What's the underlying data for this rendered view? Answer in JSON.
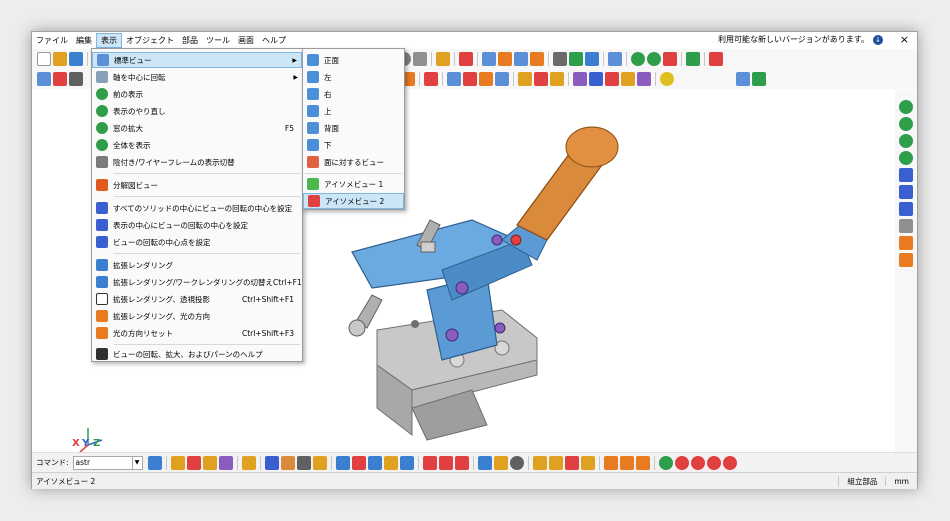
{
  "menubar": {
    "items": [
      "ファイル",
      "編集",
      "表示",
      "オブジェクト",
      "部品",
      "ツール",
      "画面",
      "ヘルプ"
    ],
    "active_index": 2
  },
  "update_notice": "利用可能な新しいバージョンがあります。",
  "view_menu": {
    "items": [
      {
        "label": "標準ビュー",
        "shortcut": "",
        "submenu": true,
        "icon": "standard-view-icon",
        "color": "#5b8fd8"
      },
      {
        "label": "軸を中心に回転",
        "shortcut": "",
        "submenu": true,
        "icon": "rotate-axis-icon",
        "color": "#8aa0b8"
      },
      {
        "label": "前の表示",
        "shortcut": "",
        "icon": "previous-view-icon",
        "color": "#2f9e4a"
      },
      {
        "label": "表示のやり直し",
        "shortcut": "",
        "icon": "redo-view-icon",
        "color": "#2f9e4a"
      },
      {
        "label": "窓の拡大",
        "shortcut": "F5",
        "icon": "zoom-window-icon",
        "color": "#2f9e4a"
      },
      {
        "label": "全体を表示",
        "shortcut": "",
        "icon": "zoom-all-icon",
        "color": "#2f9e4a"
      },
      {
        "label": "陰付き/ワイヤーフレームの表示切替",
        "shortcut": "",
        "icon": "shaded-wireframe-icon",
        "color": "#7a7a7a"
      },
      {
        "label": "分解図ビュー",
        "shortcut": "",
        "icon": "explode-view-icon",
        "color": "#e05a20"
      },
      {
        "label": "すべてのソリッドの中心にビューの回転の中心を設定",
        "shortcut": "",
        "icon": "rotation-center-solids-icon",
        "color": "#3a5fd0"
      },
      {
        "label": "表示の中心にビューの回転の中心を設定",
        "shortcut": "",
        "icon": "rotation-center-display-icon",
        "color": "#3a5fd0"
      },
      {
        "label": "ビューの回転の中心点を設定",
        "shortcut": "",
        "icon": "rotation-center-point-icon",
        "color": "#3a5fd0"
      },
      {
        "label": "拡張レンダリング",
        "shortcut": "",
        "icon": "render-icon",
        "color": "#3a7fd0"
      },
      {
        "label": "拡張レンダリング/ワークレンダリングの切替え",
        "shortcut": "Ctrl+F1",
        "icon": "render-toggle-icon",
        "color": "#3a7fd0"
      },
      {
        "label": "拡張レンダリング、透視投影",
        "shortcut": "Ctrl+Shift+F1",
        "icon": "perspective-icon",
        "color": "#ffffff"
      },
      {
        "label": "拡張レンダリング、光の方向",
        "shortcut": "",
        "icon": "light-direction-icon",
        "color": "#e87a20"
      },
      {
        "label": "光の方向リセット",
        "shortcut": "Ctrl+Shift+F3",
        "icon": "light-reset-icon",
        "color": "#e87a20"
      },
      {
        "label": "ビューの回転、拡大、およびパーンのヘルプ",
        "shortcut": "",
        "icon": "help-book-icon",
        "color": "#303030"
      }
    ]
  },
  "standard_view_submenu": {
    "items": [
      {
        "label": "正面",
        "icon": "front-view-icon",
        "color": "#4a8fd8"
      },
      {
        "label": "左",
        "icon": "left-view-icon",
        "color": "#4a8fd8"
      },
      {
        "label": "右",
        "icon": "right-view-icon",
        "color": "#4a8fd8"
      },
      {
        "label": "上",
        "icon": "top-view-icon",
        "color": "#4a8fd8"
      },
      {
        "label": "背面",
        "icon": "back-view-icon",
        "color": "#4a8fd8"
      },
      {
        "label": "下",
        "icon": "bottom-view-icon",
        "color": "#4a8fd8"
      },
      {
        "label": "面に対するビュー",
        "icon": "face-view-icon",
        "color": "#e06040"
      },
      {
        "label": "アイソメビュー 1",
        "icon": "isometric1-icon",
        "color": "#4ab84a"
      },
      {
        "label": "アイソメビュー 2",
        "icon": "isometric2-icon",
        "color": "#e04040"
      }
    ],
    "highlighted_index": 8
  },
  "axis_labels": {
    "x": "X",
    "y": "Y",
    "z": "Z"
  },
  "command": {
    "label": "コマンド:",
    "value": "astr"
  },
  "status": {
    "main": "アイソメビュー 2",
    "mode": "組立部品",
    "unit": "mm"
  },
  "toolbar_icon_colors": [
    "#5b8fd8",
    "#e0a020",
    "#3a7fd0",
    "#2f9e4a",
    "#e04040",
    "#8a5cc0",
    "#e87a20",
    "#606060"
  ]
}
